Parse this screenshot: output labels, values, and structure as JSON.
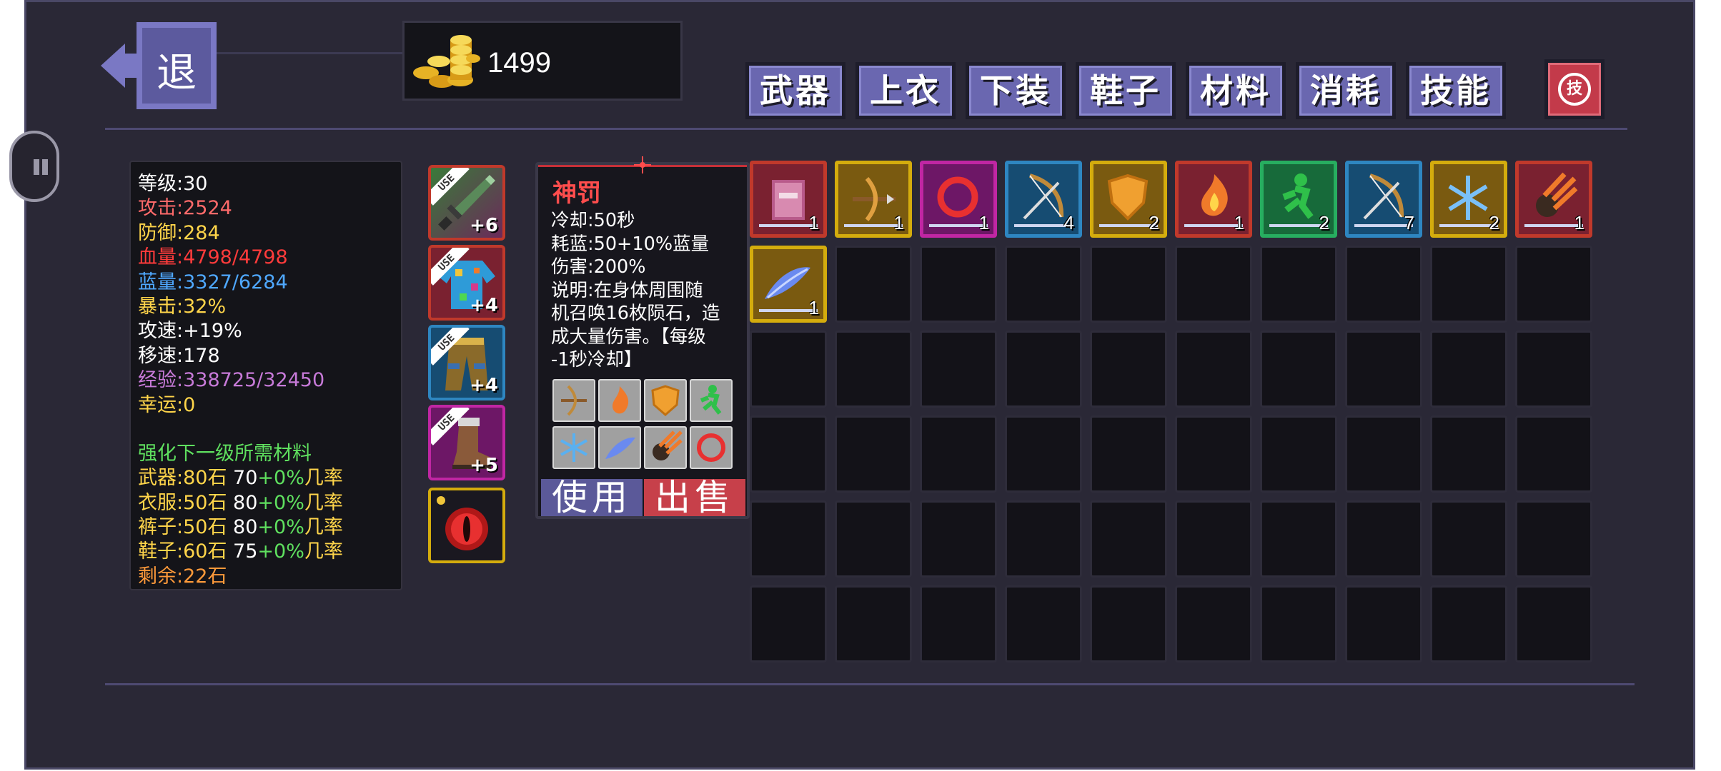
{
  "header": {
    "back_label": "退",
    "gold_count": "1499"
  },
  "tabs": [
    "武器",
    "上衣",
    "下装",
    "鞋子",
    "材料",
    "消耗",
    "技能"
  ],
  "refresh_label": "技",
  "colors": {
    "background": "#2a2836",
    "tab": "#6a67b0",
    "sell": "#c7404a",
    "use": "#5b5999"
  },
  "stats": {
    "level": {
      "label": "等级:",
      "value": "30"
    },
    "attack": {
      "label": "攻击:",
      "value": "2524"
    },
    "defense": {
      "label": "防御:",
      "value": "284"
    },
    "hp": {
      "label": "血量:",
      "value": "4798/4798"
    },
    "mp": {
      "label": "蓝量:",
      "value": "3327/6284"
    },
    "crit": {
      "label": "暴击:",
      "value": "32%"
    },
    "atk_speed": {
      "label": "攻速:",
      "value": "+19%"
    },
    "move_speed": {
      "label": "移速:",
      "value": "178"
    },
    "exp": {
      "label": "经验:",
      "value": "338725/32450"
    },
    "luck": {
      "label": "幸运:",
      "value": "0"
    }
  },
  "upgrade": {
    "title": "强化下一级所需材料",
    "rows": [
      {
        "a": "武器:80石",
        "b": "70",
        "c": "+0%",
        "d": "几率"
      },
      {
        "a": "衣服:50石",
        "b": "80",
        "c": "+0%",
        "d": "几率"
      },
      {
        "a": "裤子:50石",
        "b": "80",
        "c": "+0%",
        "d": "几率"
      },
      {
        "a": "鞋子:60石",
        "b": "75",
        "c": "+0%",
        "d": "几率"
      }
    ],
    "remaining": "剩余:22石"
  },
  "equipped": [
    {
      "name": "sword",
      "tag": "USE",
      "level": "+6",
      "border": "#c0392b"
    },
    {
      "name": "jacket",
      "tag": "USE",
      "level": "+4",
      "border": "#c0392b"
    },
    {
      "name": "pants",
      "tag": "USE",
      "level": "+4",
      "border": "#2e86c1"
    },
    {
      "name": "boots",
      "tag": "USE",
      "level": "+5",
      "border": "#c026a3"
    },
    {
      "name": "pet-eye",
      "tag": "",
      "level": "",
      "border": "#d4ac0d"
    }
  ],
  "detail": {
    "title": "神罚",
    "lines": [
      "冷却:50秒",
      "耗蓝:50+10%蓝量",
      "伤害:200%",
      "说明:在身体周围随",
      "机召唤16枚陨石，造",
      "成大量伤害。【每级",
      "-1秒冷却】"
    ],
    "use_label": "使用",
    "sell_label": "出售"
  },
  "inventory": [
    {
      "icon": "book-icon",
      "count": "1",
      "border": "#c0392b",
      "bg": "#7a2130"
    },
    {
      "icon": "crossbow-icon",
      "count": "1",
      "border": "#d4ac0d",
      "bg": "#7a5a10"
    },
    {
      "icon": "ring-icon",
      "count": "1",
      "border": "#c026a3",
      "bg": "#6d1766"
    },
    {
      "icon": "bow-icon",
      "count": "4",
      "border": "#2e86c1",
      "bg": "#164c72"
    },
    {
      "icon": "shield-icon",
      "count": "2",
      "border": "#d4ac0d",
      "bg": "#7a5a10"
    },
    {
      "icon": "fire-icon",
      "count": "1",
      "border": "#c0392b",
      "bg": "#7a2130"
    },
    {
      "icon": "runner-icon",
      "count": "2",
      "border": "#27ae60",
      "bg": "#176a3a"
    },
    {
      "icon": "bow-icon",
      "count": "7",
      "border": "#2e86c1",
      "bg": "#164c72"
    },
    {
      "icon": "snowflake-icon",
      "count": "2",
      "border": "#d4ac0d",
      "bg": "#7a5a10"
    },
    {
      "icon": "meteor-icon",
      "count": "1",
      "border": "#c0392b",
      "bg": "#7a2130"
    },
    {
      "icon": "feather-icon",
      "count": "1",
      "border": "#d4ac0d",
      "bg": "#7a5a10"
    }
  ]
}
